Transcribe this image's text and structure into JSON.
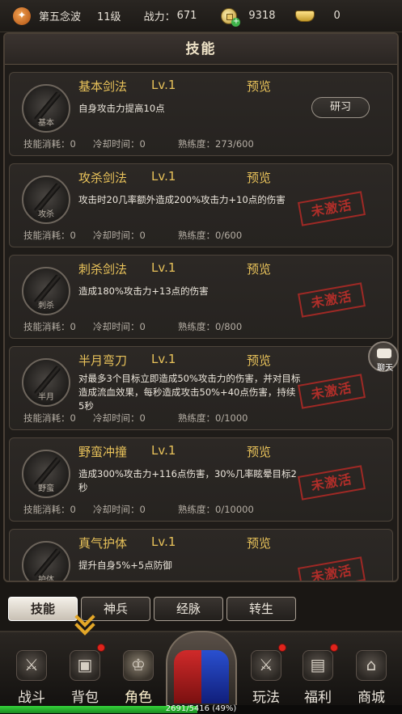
{
  "player": {
    "name": "第五念波",
    "level": "11级",
    "power_label": "战力：",
    "power_value": "671",
    "coins": "9318",
    "ingots": "0"
  },
  "panel": {
    "title": "技能"
  },
  "stats_labels": {
    "cost": "技能消耗：",
    "cooldown": "冷却时间：",
    "proficiency": "熟练度："
  },
  "skills": [
    {
      "name": "基本剑法",
      "level": "Lv.1",
      "preview": "预览",
      "icon_label": "基本",
      "desc": "自身攻击力提高10点",
      "cost": "0",
      "cooldown": "0",
      "proficiency": "273/600",
      "action": "研习",
      "status": ""
    },
    {
      "name": "攻杀剑法",
      "level": "Lv.1",
      "preview": "预览",
      "icon_label": "攻杀",
      "desc": "攻击时20几率额外造成200%攻击力+10点的伤害",
      "cost": "0",
      "cooldown": "0",
      "proficiency": "0/600",
      "action": "",
      "status": "未激活"
    },
    {
      "name": "刺杀剑法",
      "level": "Lv.1",
      "preview": "预览",
      "icon_label": "刺杀",
      "desc": "造成180%攻击力+13点的伤害",
      "cost": "0",
      "cooldown": "0",
      "proficiency": "0/800",
      "action": "",
      "status": "未激活"
    },
    {
      "name": "半月弯刀",
      "level": "Lv.1",
      "preview": "预览",
      "icon_label": "半月",
      "desc": "对最多3个目标立即造成50%攻击力的伤害，并对目标造成流血效果，每秒造成攻击50%+40点伤害，持续5秒",
      "cost": "0",
      "cooldown": "0",
      "proficiency": "0/1000",
      "action": "",
      "status": "未激活"
    },
    {
      "name": "野蛮冲撞",
      "level": "Lv.1",
      "preview": "预览",
      "icon_label": "野蛮",
      "desc": "造成300%攻击力+116点伤害，30%几率眩晕目标2秒",
      "cost": "0",
      "cooldown": "0",
      "proficiency": "0/10000",
      "action": "",
      "status": "未激活"
    },
    {
      "name": "真气护体",
      "level": "Lv.1",
      "preview": "预览",
      "icon_label": "护体",
      "desc": "提升自身5%+5点防御",
      "cost": "",
      "cooldown": "",
      "proficiency": "",
      "action": "",
      "status": "未激活"
    }
  ],
  "chat": {
    "label": "聊天"
  },
  "subtabs": [
    "技能",
    "神兵",
    "经脉",
    "转生"
  ],
  "nav": [
    {
      "label": "战斗",
      "icon": "crossed-swords-icon",
      "glyph": "⚔",
      "badge": false
    },
    {
      "label": "背包",
      "icon": "backpack-icon",
      "glyph": "▣",
      "badge": true
    },
    {
      "label": "角色",
      "icon": "character-icon",
      "glyph": "♔",
      "badge": false
    },
    {
      "label": "玩法",
      "icon": "sword-icon",
      "glyph": "⚔",
      "badge": true
    },
    {
      "label": "福利",
      "icon": "chest-icon",
      "glyph": "▤",
      "badge": true
    },
    {
      "label": "商城",
      "icon": "shop-icon",
      "glyph": "⌂",
      "badge": false
    }
  ],
  "xp": {
    "text": "2691/5416 (49%)",
    "fraction": 0.49
  },
  "colors": {
    "accent": "#e8c25a",
    "stamp": "#c8302b",
    "xp": "#34d23a"
  }
}
